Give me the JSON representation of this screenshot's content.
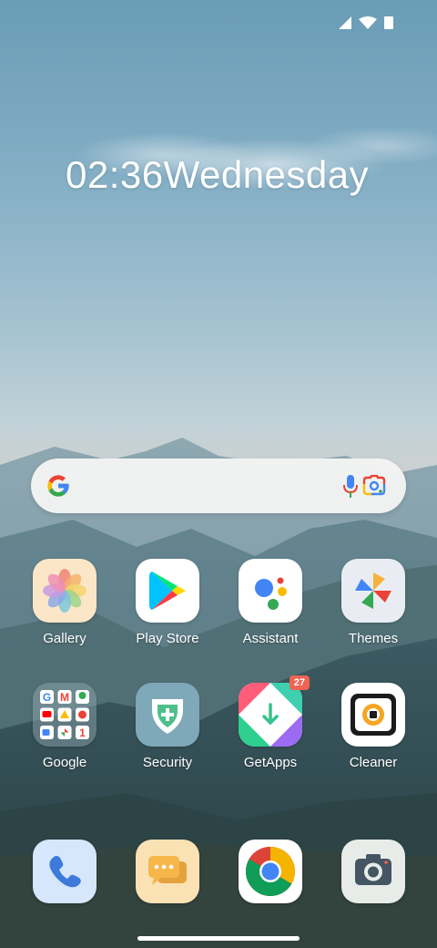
{
  "status_bar": {
    "icons": [
      "signal-icon",
      "wifi-icon",
      "battery-icon"
    ]
  },
  "clock": {
    "time_day": "02:36Wednesday"
  },
  "search_bar": {
    "icons": [
      "google-g-icon",
      "microphone-icon",
      "google-lens-icon"
    ]
  },
  "apps": [
    {
      "label": "Gallery"
    },
    {
      "label": "Play Store"
    },
    {
      "label": "Assistant"
    },
    {
      "label": "Themes"
    },
    {
      "label": "Google"
    },
    {
      "label": "Security"
    },
    {
      "label": "GetApps",
      "badge": "27"
    },
    {
      "label": "Cleaner"
    }
  ],
  "dock": {
    "icons": [
      "phone-icon",
      "messages-icon",
      "chrome-icon",
      "camera-icon"
    ]
  },
  "colors": {
    "badge": "#ef6351",
    "google_blue": "#4285F4",
    "google_red": "#EA4335",
    "google_yellow": "#FBBC05",
    "google_green": "#34A853"
  }
}
